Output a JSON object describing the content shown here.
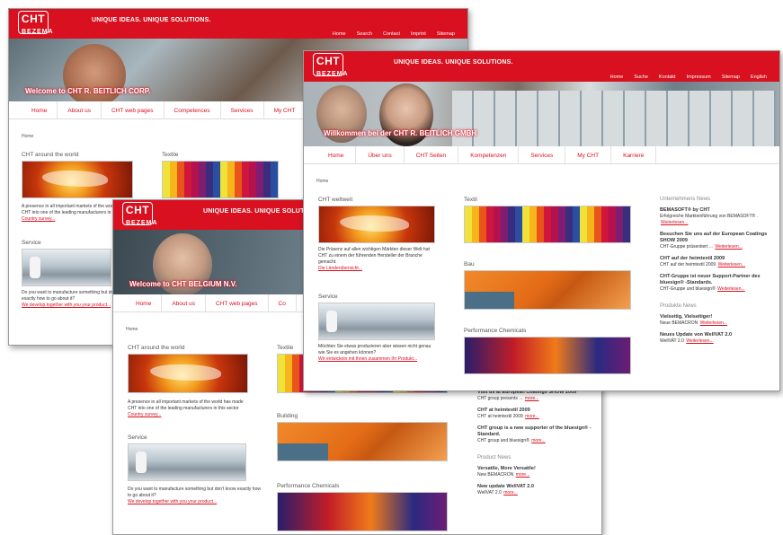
{
  "brand": {
    "logo_text": "CHT",
    "sub_brand": "BEZEMA",
    "slogan": "UNIQUE IDEAS. UNIQUE SOLUTIONS.",
    "accent_color": "#d8101f"
  },
  "win_back": {
    "topnav": [
      "Home",
      "Search",
      "Contact",
      "Imprint",
      "Sitemap"
    ],
    "hero_title": "Welcome to CHT R. BEITLICH CORP.",
    "nav": [
      "Home",
      "About us",
      "CHT web pages",
      "Competences",
      "Services",
      "My CHT"
    ],
    "crumb": "Home",
    "cht_world_title": "CHT around the world",
    "cht_world_text": "A presence in all important markets of the world has made CHT into one of the leading manufacturers in the sector",
    "cht_world_link": "Country survey...",
    "textile_title": "Textile",
    "service_title": "Service",
    "service_text": "Do you want to manufacture something but don't know exactly how to go about it?",
    "service_link": "We develop together with you your product..."
  },
  "win_mid": {
    "slogan": "UNIQUE IDEAS. UNIQUE SOLUTIO",
    "hero_title": "Welcome to CHT BELGIUM N.V.",
    "nav": [
      "Home",
      "About us",
      "CHT web pages",
      "Co"
    ],
    "crumb": "Home",
    "cht_world_title": "CHT around the world",
    "cht_world_text": "A presence in all important markets of the world has made CHT into one of the leading manufacturers in this sector",
    "cht_world_link": "Country survey...",
    "textile_title": "Textile",
    "building_title": "Building",
    "perf_title": "Performance Chemicals",
    "service_title": "Service",
    "service_text": "Do you want to manufacture something but don't know exactly how to go about it?",
    "service_link": "We develop together with you your product...",
    "news": [
      {
        "title": "Visit us at European Coatings SHOW 2009",
        "text": "CHT group presents ...",
        "link": "more..."
      },
      {
        "title": "CHT at heimtextil 2009",
        "text": "CHT at heimtextil 2009",
        "link": "more..."
      },
      {
        "title": "CHT group is a new supporter of the bluesign® -Standard.",
        "text": "CHT group and bluesign®",
        "link": "more..."
      }
    ],
    "product_news_title": "Product News",
    "product_news": [
      {
        "title": "Versatile, More Versatile!",
        "text": "New BEMACRON",
        "link": "more..."
      },
      {
        "title": "New update WellVAT 2.0",
        "text": "WellVAT 2.0",
        "link": "more..."
      }
    ]
  },
  "win_front": {
    "topnav": [
      "Home",
      "Suche",
      "Kontakt",
      "Impressum",
      "Sitemap",
      "English"
    ],
    "hero_title": "Willkommen bei der CHT R. BEITLICH GMBH",
    "nav": [
      "Home",
      "Über uns",
      "CHT Seiten",
      "Kompetenzen",
      "Services",
      "My CHT",
      "Karriere"
    ],
    "crumb": "Home",
    "cht_world_title": "CHT weltweit",
    "cht_world_text": "Die Präsenz auf allen wichtigen Märkten dieser Welt hat CHT zu einem der führenden Hersteller der Branche gemacht.",
    "cht_world_link": "Die Länderübersicht...",
    "service_title": "Service",
    "service_text": "Möchten Sie etwas produzieren aber wissen nicht genau wie Sie es angehen können?",
    "service_link": "Wir entwickeln mit Ihnen zusammen Ihr Produkt...",
    "textile_title": "Textil",
    "bau_title": "Bau",
    "perf_title": "Performance Chemicals",
    "company_news_title": "Unternehmens News",
    "company_news": [
      {
        "title": "BEMASOFT® by CHT",
        "text": "Erfolgreiche Markteinführung von BEMASOFT® .",
        "link": "Weiterlesen..."
      },
      {
        "title": "Besuchen Sie uns auf der European Coatings SHOW 2009",
        "text": "CHT-Gruppe präsentiert ...",
        "link": "Weiterlesen..."
      },
      {
        "title": "CHT auf der heimtextil 2009",
        "text": "CHT auf der heimtextil 2009",
        "link": "Weiterlesen..."
      },
      {
        "title": "CHT-Gruppe ist neuer Support-Partner des bluesign® -Standards.",
        "text": "CHT-Gruppe und bluesign®",
        "link": "Weiterlesen..."
      }
    ],
    "product_news_title": "Produkte News",
    "product_news": [
      {
        "title": "Vielseitig, Vielseitiger!",
        "text": "Neue BEMACRON",
        "link": "Weiterlesen..."
      },
      {
        "title": "Neues Update von WellVAT 2.0",
        "text": "WellVAT 2.0",
        "link": "Weiterlesen..."
      }
    ]
  }
}
